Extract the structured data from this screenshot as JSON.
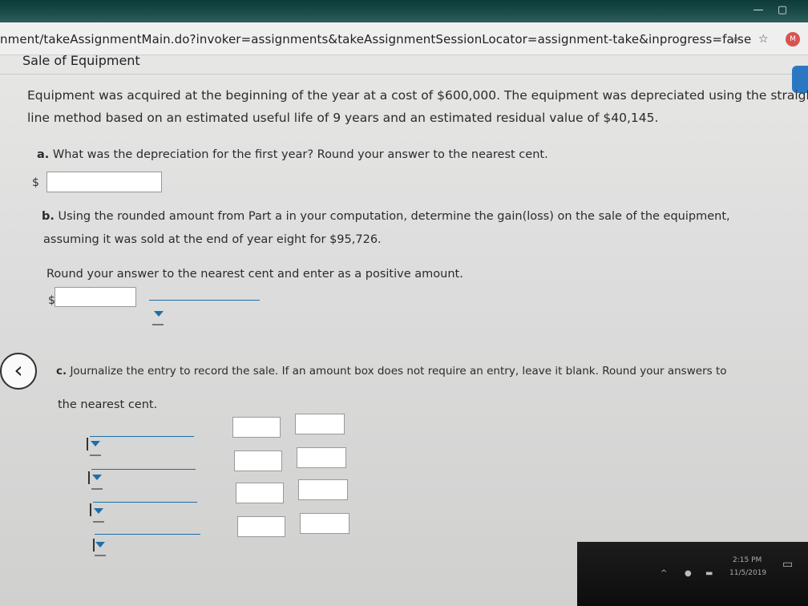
{
  "browser": {
    "url": "nment/takeAssignmentMain.do?invoker=assignments&takeAssignmentSessionLocator=assignment-take&inprogress=false",
    "avatar_initial": "M"
  },
  "page": {
    "title": "Sale of Equipment",
    "intro_line1": "Equipment was acquired at the beginning of the year at a cost of $600,000. The equipment was depreciated using the straight-",
    "intro_line2": "line method based on an estimated useful life of 9 years and an estimated residual value of $40,145."
  },
  "part_a": {
    "letter": "a.",
    "question": "What was the depreciation for the first year? Round your answer to the nearest cent.",
    "currency": "$",
    "value": ""
  },
  "part_b": {
    "letter": "b.",
    "question_line1": "Using the rounded amount from Part a in your computation, determine the gain(loss) on the sale of the equipment,",
    "question_line2": "assuming it was sold at the end of year eight for $95,726.",
    "instruction": "Round your answer to the nearest cent and enter as a positive amount.",
    "currency": "$",
    "value": ""
  },
  "part_c": {
    "letter": "c.",
    "question_line1": "Journalize the entry to record the sale. If an amount box does not require an entry, leave it blank. Round your answers to",
    "question_line2": "the nearest cent.",
    "rows": [
      {
        "account": "",
        "debit": "",
        "credit": ""
      },
      {
        "account": "",
        "debit": "",
        "credit": ""
      },
      {
        "account": "",
        "debit": "",
        "credit": ""
      },
      {
        "account": "",
        "debit": "",
        "credit": ""
      }
    ]
  },
  "taskbar": {
    "time": "2:15 PM",
    "date": "11/5/2019"
  },
  "icons": [
    "search-icon",
    "star-icon",
    "back-arrow-icon",
    "dropdown-caret-icon",
    "notification-icon"
  ]
}
